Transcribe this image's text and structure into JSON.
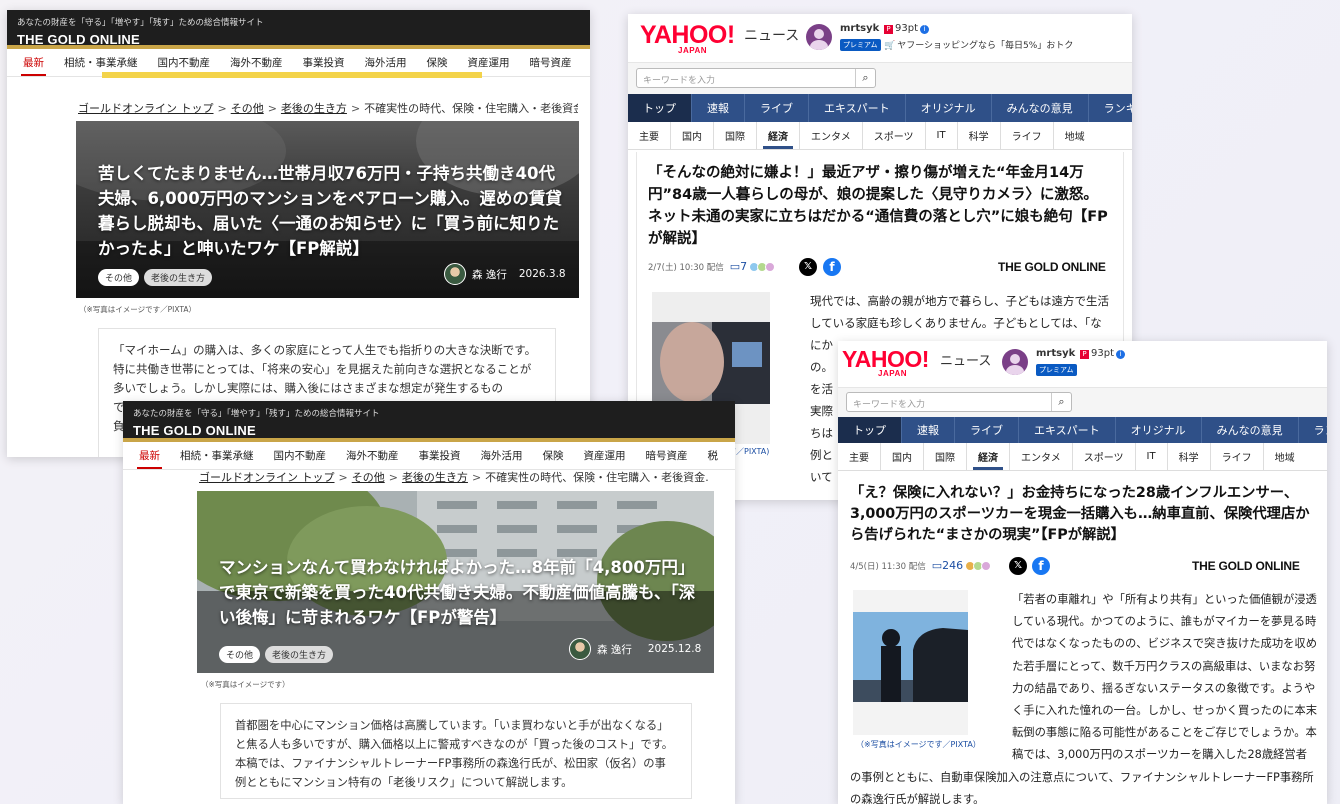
{
  "gold": {
    "tagline": "あなたの財産を「守る」「増やす」「残す」ための総合情報サイト",
    "logo": "THE GOLD ONLINE",
    "nav": [
      "最新",
      "相続・事業承継",
      "国内不動産",
      "海外不動産",
      "事業投資",
      "海外活用",
      "保険",
      "資産運用",
      "暗号資産",
      "税"
    ],
    "breadcrumb": {
      "home": "ゴールドオンライン トップ",
      "cat": "その他",
      "sub": "老後の生き方",
      "current": "不確実性の時代、保険・住宅購入・老後資金…"
    },
    "tags": [
      "その他",
      "老後の生き方"
    ],
    "author": "森 逸行",
    "caption": "（※写真はイメージです／PIXTA）",
    "caption2": "（※写真はイメージです）"
  },
  "article1": {
    "title": "苦しくてたまりません…世帯月収76万円・子持ち共働き40代夫婦、6,000万円のマンションをペアローン購入。遅めの賃貸暮らし脱却も、届いた〈一通のお知らせ〉に「買う前に知りたかったよ」と呻いたワケ【FP解説】",
    "date": "2026.3.8",
    "lead": "「マイホーム」の購入は、多くの家庭にとって人生でも指折りの大きな決断です。特に共働き世帯にとっては、「将来の安心」を見据えた前向きな選択となることが多いでしょう。しかし実際には、購入後にはさまざまな想定が発生するもので……。本稿で",
    "lead_tail": "負"
  },
  "article2": {
    "title": "マンションなんて買わなければよかった…8年前「4,800万円」で東京で新築を買った40代共働き夫婦。不動産価値高騰も、「深い後悔」に苛まれるワケ【FPが警告】",
    "date": "2025.12.8",
    "lead": "首都圏を中心にマンション価格は高騰しています。「いま買わないと手が出なくなる」と焦る人も多いですが、購入価格以上に警戒すべきなのが「買った後のコスト」です。本稿では、ファイナンシャルトレーナーFP事務所の森逸行氏が、松田家（仮名）の事例とともにマンション特有の「老後リスク」について解説します。"
  },
  "yahoo": {
    "logo": "YAHOO!",
    "logo_sub": "JAPAN",
    "news": "ニュース",
    "user": "mrtsyk",
    "premium": "プレミアム",
    "points": "93pt",
    "shop": "ヤフーショッピングなら「毎日5%」おトク",
    "search_placeholder": "キーワードを入力",
    "tabs": [
      "トップ",
      "速報",
      "ライブ",
      "エキスパート",
      "オリジナル",
      "みんなの意見",
      "ランキング"
    ],
    "subtabs": [
      "主要",
      "国内",
      "国際",
      "経済",
      "エンタメ",
      "スポーツ",
      "IT",
      "科学",
      "ライフ",
      "地域"
    ],
    "source": "THE GOLD ONLINE"
  },
  "article3": {
    "title": "「そんなの絶対に嫌よ！」最近アザ・擦り傷が増えた“年金月14万円”84歳一人暮らしの母が、娘の提案した〈見守りカメラ〉に激怒。ネット未通の実家に立ちはだかる“通信費の落とし穴”に娘も絶句【FPが解説】",
    "date": "2/7(土) 10:30 配信",
    "comments": "7",
    "body": [
      "現代では、高齢の親が地方で暮らし、子どもは遠方で生活",
      "している家庭も珍しくありません。子どもとしては、「な",
      "にか",
      "の。",
      "を活",
      "実際",
      "ちは",
      "例と",
      "いて"
    ],
    "caption": "す／PIXTA)"
  },
  "article4": {
    "title": "「え？保険に入れない？」お金持ちになった28歳インフルエンサー、3,000万円のスポーツカーを現金一括購入も…納車直前、保険代理店から告げられた“まさかの現実”【FPが解説】",
    "date": "4/5(日) 11:30 配信",
    "comments": "246",
    "body": "「若者の車離れ」や「所有より共有」といった価値観が浸透している現代。かつてのように、誰もがマイカーを夢見る時代ではなくなったものの、ビジネスで突き抜けた成功を収めた若手層にとって、数千万円クラスの高級車は、いまなお努力の結晶であり、揺るぎないステータスの象徴です。ようやく手に入れた憧れの一台。しかし、せっかく買ったのに本末転倒の事態に陥る可能性があることをご存じでしょうか。本稿では、3,000万円のスポーツカーを購入した28歳経営者の事例とともに、自動車保険加入の注意点について、ファイナンシャルトレーナーFP事務所の森逸行氏が解説します。",
    "caption": "（※写真はイメージです／PIXTA）"
  }
}
